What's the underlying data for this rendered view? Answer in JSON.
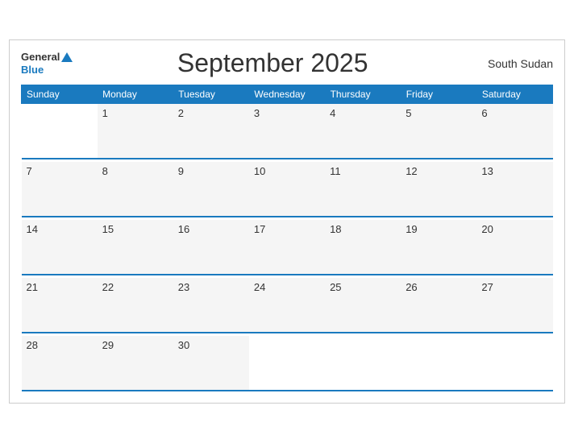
{
  "header": {
    "logo_general": "General",
    "logo_blue": "Blue",
    "title": "September 2025",
    "region": "South Sudan"
  },
  "weekdays": [
    "Sunday",
    "Monday",
    "Tuesday",
    "Wednesday",
    "Thursday",
    "Friday",
    "Saturday"
  ],
  "weeks": [
    [
      "",
      "1",
      "2",
      "3",
      "4",
      "5",
      "6"
    ],
    [
      "7",
      "8",
      "9",
      "10",
      "11",
      "12",
      "13"
    ],
    [
      "14",
      "15",
      "16",
      "17",
      "18",
      "19",
      "20"
    ],
    [
      "21",
      "22",
      "23",
      "24",
      "25",
      "26",
      "27"
    ],
    [
      "28",
      "29",
      "30",
      "",
      "",
      "",
      ""
    ]
  ]
}
